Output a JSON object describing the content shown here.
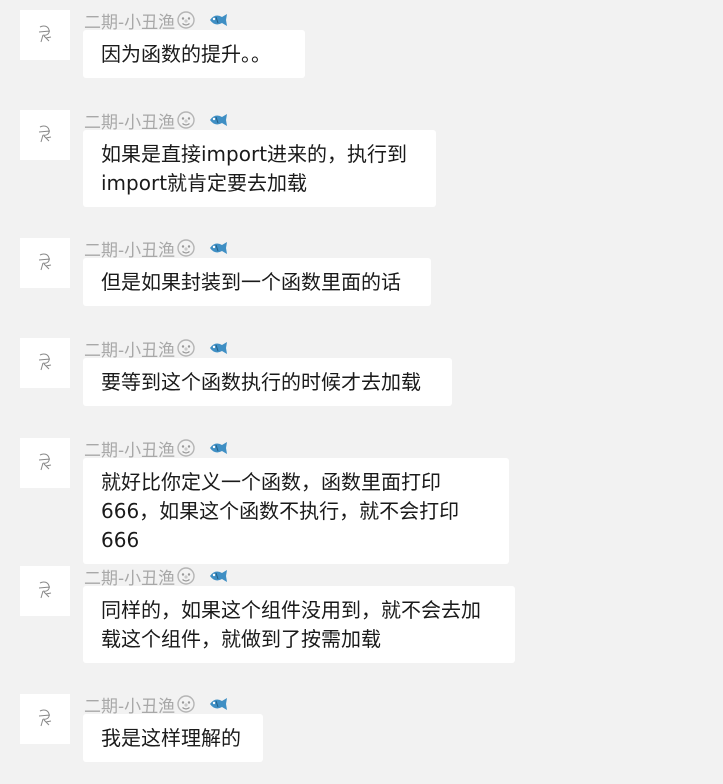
{
  "colors": {
    "background": "#f2f2f2",
    "bubble": "#ffffff",
    "sender_name": "#a8a8a8",
    "message_text": "#1a1a1a"
  },
  "sender": {
    "name": "二期-小丑渔",
    "emoji_icon": "clown-face-icon",
    "badge_icon": "fish-icon"
  },
  "messages": [
    {
      "text": "因为函数的提升。。"
    },
    {
      "text": "如果是直接import进来的，执行到import就肯定要去加载"
    },
    {
      "text": "但是如果封装到一个函数里面的话"
    },
    {
      "text": "要等到这个函数执行的时候才去加载"
    },
    {
      "text": "就好比你定义一个函数，函数里面打印666，如果这个函数不执行，就不会打印666"
    },
    {
      "text": "同样的，如果这个组件没用到，就不会去加载这个组件，就做到了按需加载"
    },
    {
      "text": "我是这样理解的"
    }
  ]
}
